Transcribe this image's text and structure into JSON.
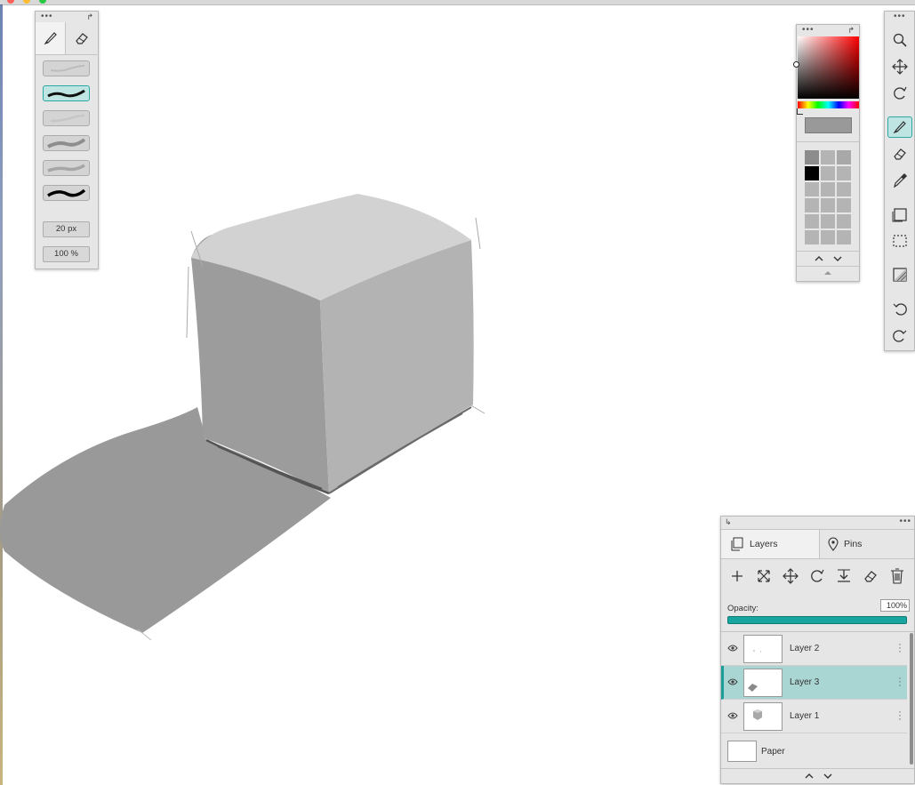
{
  "brush_panel": {
    "tabs": [
      {
        "name": "brush",
        "icon": "brush-icon",
        "active": true
      },
      {
        "name": "eraser",
        "icon": "eraser-icon",
        "active": false
      }
    ],
    "presets": [
      {
        "id": "preset-1",
        "selected": false
      },
      {
        "id": "preset-2",
        "selected": true
      },
      {
        "id": "preset-3",
        "selected": false
      },
      {
        "id": "preset-4",
        "selected": false
      },
      {
        "id": "preset-5",
        "selected": false
      },
      {
        "id": "preset-6",
        "selected": false
      }
    ],
    "size_value": "20 px",
    "opacity_value": "100 %"
  },
  "color_panel": {
    "current_color": "#999999",
    "hue_color": "#ff0000",
    "swatches": [
      "#8c8c8c",
      "#b4b4b4",
      "#a8a8a8",
      "#000000"
    ],
    "up_icon": "chevron-up-icon",
    "down_icon": "chevron-down-icon",
    "expand_icon": "triangle-up-icon"
  },
  "tool_strip": {
    "tools": [
      {
        "name": "zoom",
        "icon": "magnifier-icon",
        "selected": false
      },
      {
        "name": "move",
        "icon": "move-icon",
        "selected": false
      },
      {
        "name": "rotate",
        "icon": "rotate-icon",
        "selected": false
      },
      {
        "name": "brush",
        "icon": "brush-icon",
        "selected": true
      },
      {
        "name": "eraser",
        "icon": "eraser-icon",
        "selected": false
      },
      {
        "name": "eyedropper",
        "icon": "eyedropper-icon",
        "selected": false
      },
      {
        "name": "layer-rect",
        "icon": "layer-rect-icon",
        "selected": false
      },
      {
        "name": "selection",
        "icon": "selection-rect-icon",
        "selected": false
      },
      {
        "name": "fill",
        "icon": "fill-icon",
        "selected": false
      },
      {
        "name": "undo",
        "icon": "undo-icon",
        "selected": false
      },
      {
        "name": "redo",
        "icon": "redo-icon",
        "selected": false
      }
    ]
  },
  "layers_panel": {
    "tabs": [
      {
        "label": "Layers",
        "icon": "layers-icon",
        "active": true
      },
      {
        "label": "Pins",
        "icon": "pin-icon",
        "active": false
      }
    ],
    "actions": [
      "add-icon",
      "fit-icon",
      "move-icon",
      "rotate-icon",
      "merge-down-icon",
      "clear-icon",
      "trash-icon"
    ],
    "opacity_label": "Opacity:",
    "opacity_value": "100%",
    "opacity_fraction": 1.0,
    "accent_color": "#19a59f",
    "layers": [
      {
        "name": "Layer 2",
        "visible": true,
        "selected": false
      },
      {
        "name": "Layer 3",
        "visible": true,
        "selected": true
      },
      {
        "name": "Layer 1",
        "visible": true,
        "selected": false
      }
    ],
    "paper_label": "Paper"
  }
}
